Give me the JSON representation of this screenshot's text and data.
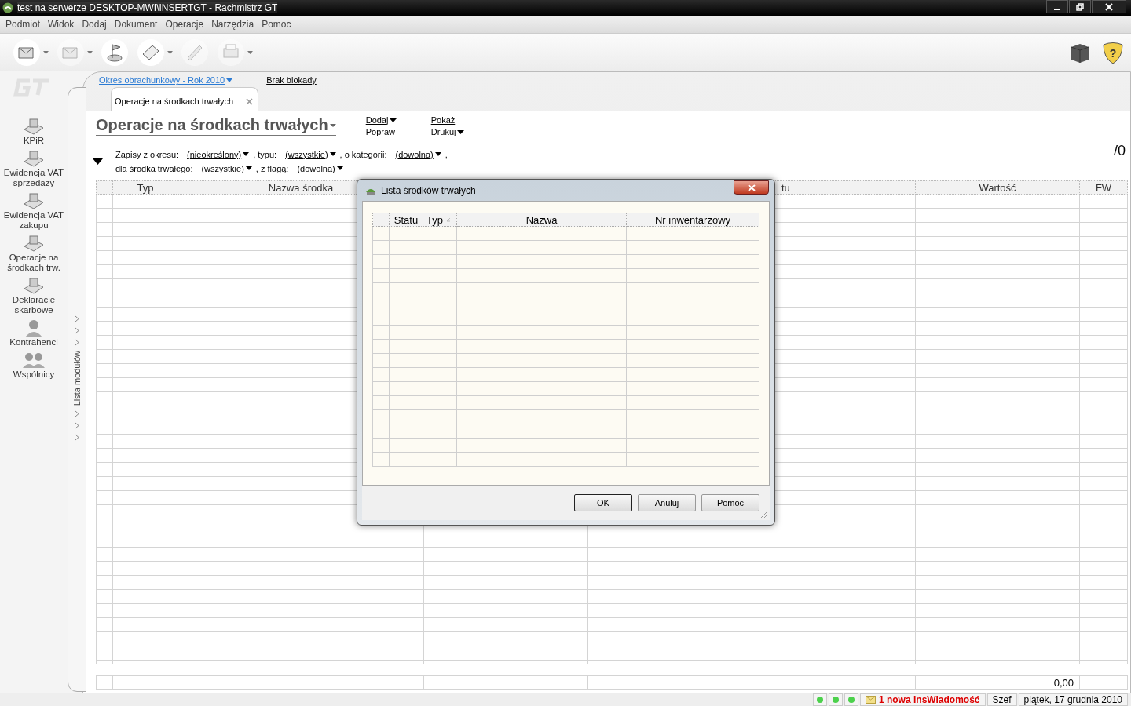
{
  "window": {
    "title": "test na serwerze DESKTOP-MWI\\INSERTGT - Rachmistrz GT"
  },
  "menu": [
    "Podmiot",
    "Widok",
    "Dodaj",
    "Dokument",
    "Operacje",
    "Narzędzia",
    "Pomoc"
  ],
  "toolbar": [
    {
      "dropdown": true,
      "disabled": false
    },
    {
      "dropdown": true,
      "disabled": true
    },
    {
      "dropdown": false,
      "disabled": false
    },
    {
      "dropdown": true,
      "disabled": false
    },
    {
      "dropdown": false,
      "disabled": true
    },
    {
      "dropdown": true,
      "disabled": true
    }
  ],
  "help_button": "?",
  "period_link": "Okres obrachunkowy - Rok 2010",
  "lock_link": "Brak blokady",
  "tabs": [
    {
      "label": "Operacje na środkach trwałych",
      "selected": true
    }
  ],
  "heading": "Operacje na środkach trwałych",
  "actions": [
    {
      "label": "Dodaj",
      "dropdown": true
    },
    {
      "label": "Popraw",
      "dropdown": false
    },
    {
      "label": "Pokaż",
      "dropdown": false
    },
    {
      "label": "Drukuj",
      "dropdown": true
    }
  ],
  "filters": [
    [
      {
        "kind": "text",
        "text": "Zapisy z okresu:"
      },
      {
        "kind": "dropdown",
        "text": "(nieokreślony)"
      },
      {
        "kind": "text",
        "text": ", typu:"
      },
      {
        "kind": "dropdown",
        "text": "(wszystkie)"
      },
      {
        "kind": "text",
        "text": ", o kategorii:"
      },
      {
        "kind": "dropdown",
        "text": "(dowolna)"
      },
      {
        "kind": "text",
        "text": ","
      }
    ],
    [
      {
        "kind": "text",
        "text": "dla środka trwałego:"
      },
      {
        "kind": "dropdown",
        "text": "(wszystkie)"
      },
      {
        "kind": "text",
        "text": ", z flagą:"
      },
      {
        "kind": "dropdown",
        "text": "(dowolna)"
      }
    ]
  ],
  "counter": "/0",
  "sidebar": {
    "items": [
      "KPiR",
      "Ewidencja VAT sprzedaży",
      "Ewidencja VAT zakupu",
      "Operacje na środkach trw.",
      "Deklaracje skarbowe",
      "Kontrahenci",
      "Wspólnicy"
    ],
    "module_bar": "Lista modułów"
  },
  "table": {
    "columns": [
      null,
      "Typ",
      "Nazwa środka",
      null,
      "tu",
      "Wartość",
      "FW"
    ],
    "total": "0,00"
  },
  "dialog": {
    "title": "Lista środków trwałych",
    "columns": [
      {
        "sorted": false
      },
      {
        "label": "Statu",
        "sorted": false
      },
      {
        "label": "Typ",
        "sorted": true
      },
      {
        "label": "Nazwa",
        "sorted": false
      },
      {
        "label": "Nr inwentarzowy",
        "sorted": false
      }
    ],
    "buttons": [
      {
        "label": "OK",
        "default": true
      },
      {
        "label": "Anuluj",
        "default": false
      },
      {
        "label": "Pomoc",
        "default": false
      }
    ]
  },
  "status_bar": {
    "indicators": [
      {
        "color": "#4cd14c"
      },
      {
        "color": "#4cd14c"
      },
      {
        "color": "#4cd14c"
      }
    ],
    "message": "1 nowa InsWiadomość",
    "user": "Szef",
    "date": "piątek, 17 grudnia 2010"
  }
}
